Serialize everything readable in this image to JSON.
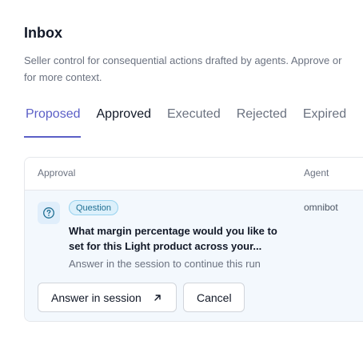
{
  "header": {
    "title": "Inbox",
    "subtitle_line1": "Seller control for consequential actions drafted by agents. Approve or",
    "subtitle_line2": "for more context."
  },
  "tabs": [
    {
      "label": "Proposed",
      "active": true
    },
    {
      "label": "Approved",
      "active": false
    },
    {
      "label": "Executed",
      "active": false
    },
    {
      "label": "Rejected",
      "active": false
    },
    {
      "label": "Expired",
      "active": false
    }
  ],
  "table": {
    "columns": [
      "Approval",
      "Agent"
    ],
    "rows": [
      {
        "icon": "question-circle-icon",
        "badge": "Question",
        "question_line1": "What margin percentage would you like to",
        "question_line2": "set for this Light product across your...",
        "hint": "Answer in the session to continue this run",
        "agent": "omnibot",
        "actions": {
          "answer_label": "Answer in session",
          "answer_icon": "arrow-up-right-icon",
          "cancel_label": "Cancel"
        }
      }
    ]
  },
  "colors": {
    "accent": "#5b5fc7",
    "badge_bg": "#dcf0fb",
    "badge_border": "#98d3ef",
    "row_bg": "#f3f8fd"
  }
}
